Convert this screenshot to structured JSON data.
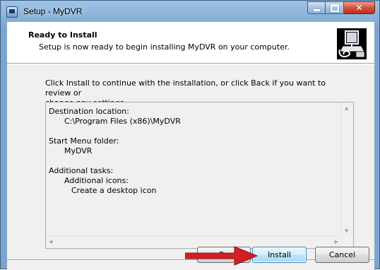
{
  "window": {
    "title": "Setup - MyDVR",
    "app_icon": "setup-icon",
    "controls": {
      "minimize": "minimize-icon",
      "maximize": "maximize-icon",
      "close": "close-icon"
    }
  },
  "header": {
    "title": "Ready to Install",
    "subtitle": "Setup is now ready to begin installing MyDVR on your computer.",
    "image": "installer-computer-icon"
  },
  "instruction": {
    "line1": "Click Install to continue with the installation, or click Back if you want to review or",
    "line2": "change any settings."
  },
  "summary": {
    "destination_label": "Destination location:",
    "destination_value": "C:\\Program Files (x86)\\MyDVR",
    "start_menu_label": "Start Menu folder:",
    "start_menu_value": "MyDVR",
    "tasks_label": "Additional tasks:",
    "tasks_group": "Additional icons:",
    "tasks_item": "Create a desktop icon"
  },
  "buttons": {
    "back": "< Back",
    "install": "Install",
    "cancel": "Cancel"
  },
  "annotation": {
    "arrow_color": "#d21f26"
  },
  "colors": {
    "accent": "#3c7fb1",
    "window_frame": "#7ba5cf"
  }
}
